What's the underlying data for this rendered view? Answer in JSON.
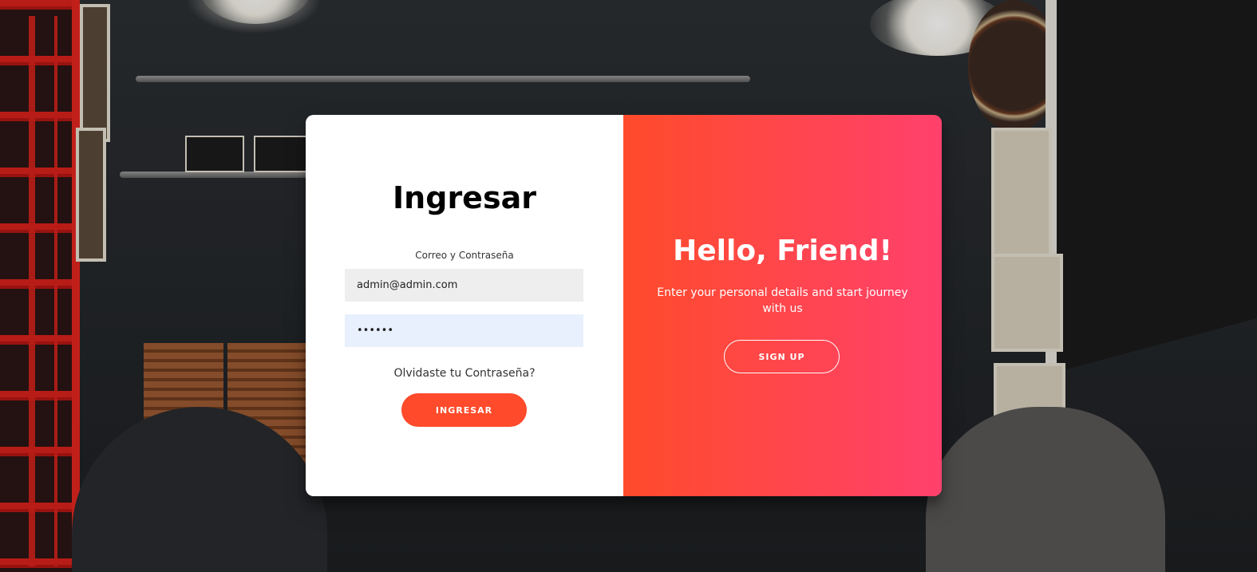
{
  "login": {
    "title": "Ingresar",
    "subtitle": "Correo y Contraseña",
    "email_value": "admin@admin.com",
    "password_value": "••••••",
    "forgot_link": "Olvidaste tu Contraseña?",
    "submit_label": "INGRESAR"
  },
  "overlay": {
    "heading": "Hello, Friend!",
    "text": "Enter your personal details and start journey with us",
    "signup_label": "SIGN UP"
  },
  "colors": {
    "accent": "#ff4b2b",
    "accent_gradient_end": "#ff416c",
    "email_field_bg": "#eeeeee",
    "password_field_bg": "#e8f0fe"
  }
}
